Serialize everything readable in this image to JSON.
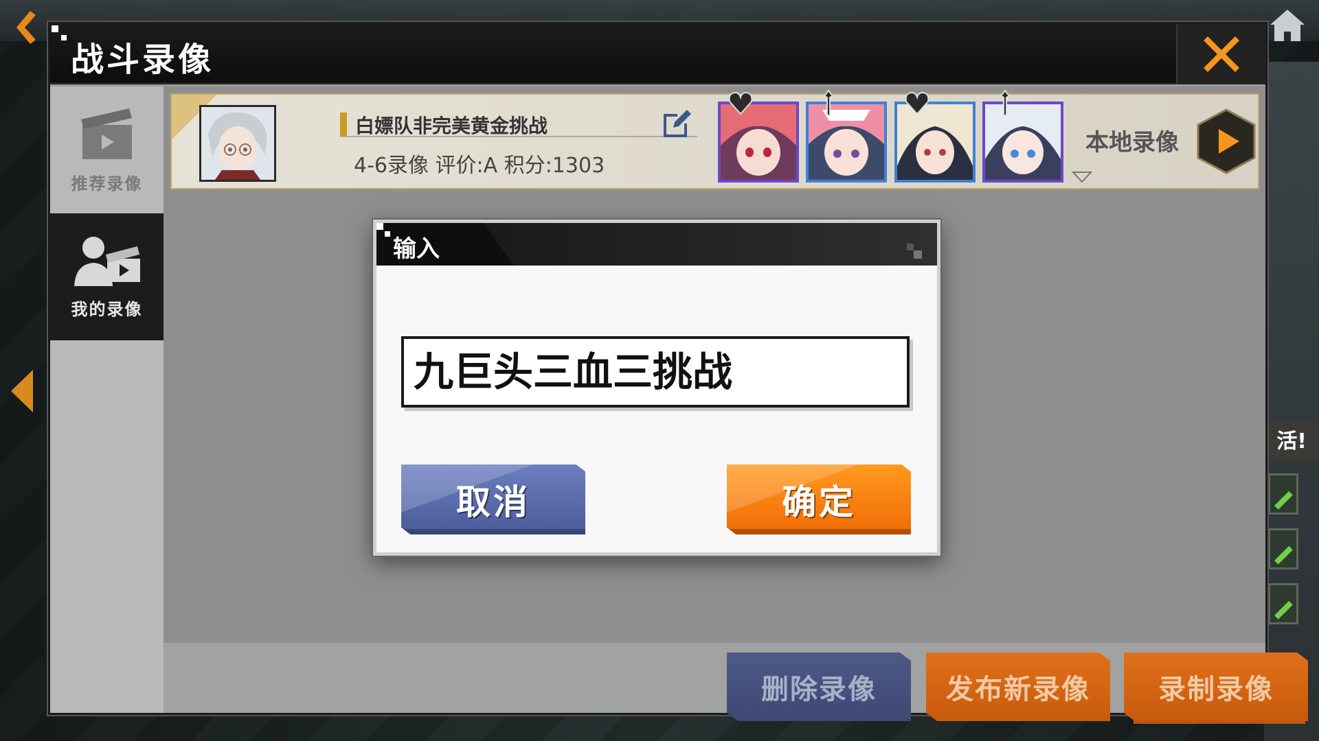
{
  "window": {
    "title": "战斗录像",
    "close_icon": "close-x-icon"
  },
  "sidebar": {
    "items": [
      {
        "label": "推荐录像",
        "icon": "clapperboard-icon",
        "active": false
      },
      {
        "label": "我的录像",
        "icon": "user-clapperboard-icon",
        "active": true
      }
    ]
  },
  "replay": {
    "name": "白嫖队非完美黄金挑战",
    "meta": "4-6录像 评价:A 积分:1303",
    "local_label": "本地录像",
    "edit_icon": "edit-icon",
    "play_icon": "play-icon",
    "dropdown_icon": "chevron-down-icon"
  },
  "bottom_bar": {
    "delete_label": "删除录像",
    "publish_label": "发布新录像",
    "record_label": "录制录像"
  },
  "dialog": {
    "title": "输入",
    "input_value": "九巨头三血三挑战",
    "cancel_label": "取消",
    "confirm_label": "确定"
  },
  "colors": {
    "accent_orange": "#f47a0d",
    "accent_blue": "#5566a8",
    "gold": "#c79a23"
  }
}
